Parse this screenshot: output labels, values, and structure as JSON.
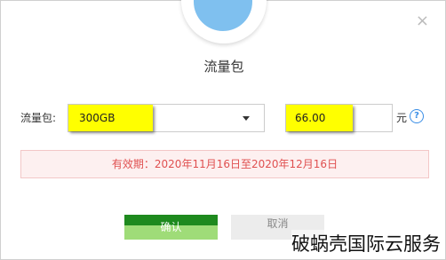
{
  "dialog": {
    "title": "流量包",
    "close_glyph": "×"
  },
  "form": {
    "package_label": "流量包:",
    "package_selected": "300GB",
    "price_value": "66.00",
    "price_unit": "元",
    "help_glyph": "?"
  },
  "validity": {
    "text": "有效期：2020年11月16日至2020年12月16日"
  },
  "buttons": {
    "confirm_label": "确认",
    "cancel_label": "取消"
  },
  "watermark": {
    "text": "破蜗壳国际云服务"
  },
  "colors": {
    "highlight": "#ffff00",
    "confirm_green": "#1e8a1e",
    "validity_text": "#e05050",
    "help_blue": "#3a8ee6",
    "icon_blue": "#7fc0ef"
  },
  "icons": {
    "top": "package-edit-icon",
    "close": "close-icon",
    "help": "help-icon",
    "dropdown": "chevron-down-icon"
  }
}
